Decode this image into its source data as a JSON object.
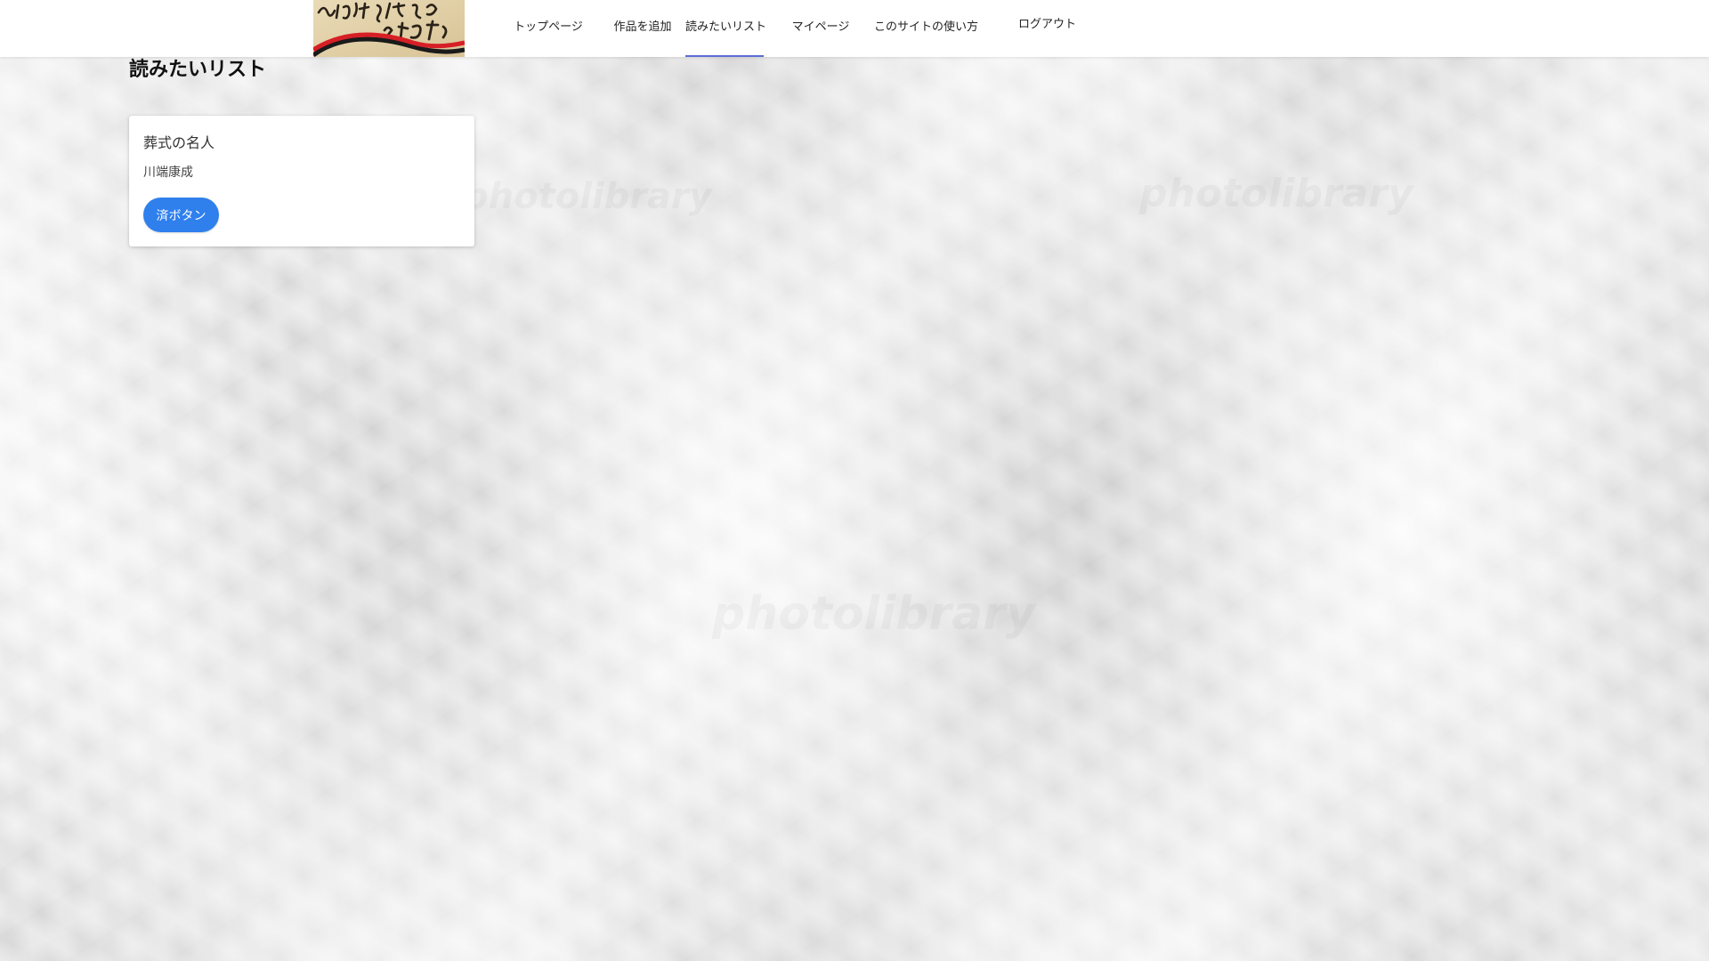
{
  "header": {
    "logo_text": "みんなで作る文学史",
    "nav": {
      "top": "トップページ",
      "add_work": "作品を追加",
      "want_list": "読みたいリスト",
      "mypage": "マイページ",
      "howto": "このサイトの使い方",
      "logout": "ログアウト"
    },
    "active_nav": "want_list",
    "accent_color": "#5b6dd6"
  },
  "page": {
    "title": "読みたいリスト"
  },
  "want_list": {
    "items": [
      {
        "title": "葬式の名人",
        "author": "川端康成",
        "button_label": "済ボタン",
        "button_color": "#2f80ed"
      }
    ]
  },
  "background": {
    "watermark_text": "photolibrary"
  }
}
